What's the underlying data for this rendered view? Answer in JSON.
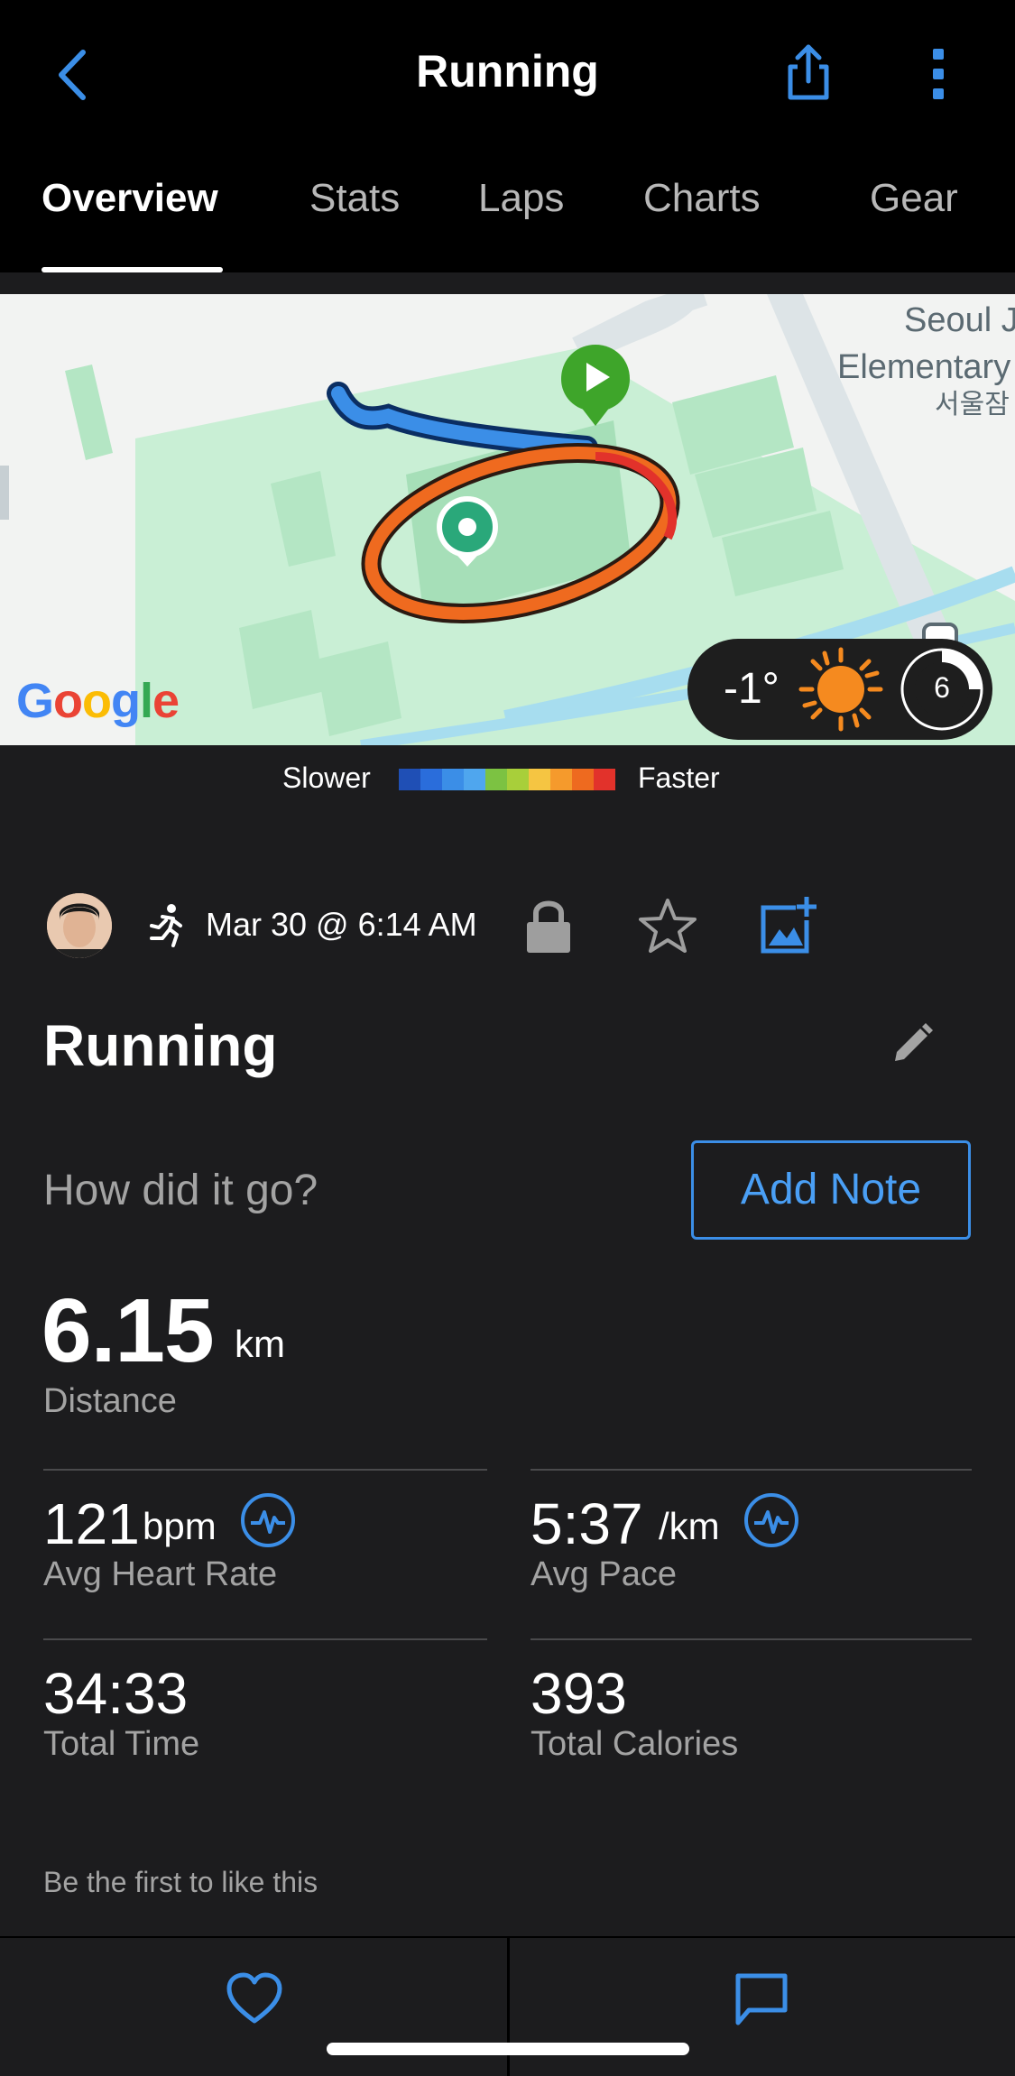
{
  "header": {
    "title": "Running"
  },
  "tabs": [
    {
      "label": "Overview",
      "active": true
    },
    {
      "label": "Stats"
    },
    {
      "label": "Laps"
    },
    {
      "label": "Charts"
    },
    {
      "label": "Gear"
    }
  ],
  "map": {
    "place_label_line1": "Seoul J",
    "place_label_line2": "Elementary",
    "place_label_line3": "서울잠",
    "provider": "Google",
    "weather": {
      "temperature": "-1°",
      "icon": "sun-icon",
      "time_badge": "6"
    }
  },
  "legend": {
    "slower_label": "Slower",
    "faster_label": "Faster",
    "colors": [
      "#1f4fb5",
      "#2a6ddb",
      "#3b8ee7",
      "#4fa6ee",
      "#7cc242",
      "#a8cf3a",
      "#f5c542",
      "#f59a2c",
      "#ee6a1f",
      "#e2322b"
    ]
  },
  "activity": {
    "date": "Mar 30 @ 6:14 AM",
    "title": "Running",
    "prompt": "How did it go?",
    "add_note_label": "Add Note"
  },
  "stats": {
    "distance": {
      "value": "6.15",
      "unit": "km",
      "label": "Distance"
    },
    "heart_rate": {
      "value": "121",
      "unit": "bpm",
      "label": "Avg Heart Rate"
    },
    "pace": {
      "value": "5:37",
      "unit": "/km",
      "label": "Avg Pace"
    },
    "time": {
      "value": "34:33",
      "label": "Total Time"
    },
    "calories": {
      "value": "393",
      "label": "Total Calories"
    }
  },
  "social": {
    "likes_text": "Be the first to like this"
  },
  "colors": {
    "accent": "#4a9ff5",
    "background": "#1c1c1e",
    "header": "#000000"
  }
}
